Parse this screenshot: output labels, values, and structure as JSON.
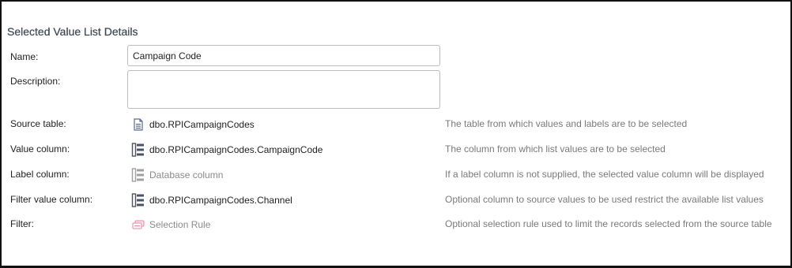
{
  "section": {
    "title": "Selected Value List Details"
  },
  "fields": {
    "name": {
      "label": "Name:",
      "value": "Campaign Code"
    },
    "description": {
      "label": "Description:",
      "value": ""
    }
  },
  "rows": {
    "source_table": {
      "label": "Source table:",
      "value": "dbo.RPICampaignCodes",
      "icon": "table-document-icon",
      "help": "The table from which values and labels are to be selected"
    },
    "value_column": {
      "label": "Value column:",
      "value": "dbo.RPICampaignCodes.CampaignCode",
      "icon": "database-column-icon",
      "help": "The column from which list values are to be selected"
    },
    "label_column": {
      "label": "Label column:",
      "value": "Database column",
      "icon": "database-column-icon",
      "help": "If a label column is not supplied, the selected value column will be displayed"
    },
    "filter_value_column": {
      "label": "Filter value column:",
      "value": "dbo.RPICampaignCodes.Channel",
      "icon": "database-column-icon",
      "help": "Optional column to source values to be used restrict the available list values"
    },
    "filter": {
      "label": "Filter:",
      "value": "Selection Rule",
      "icon": "selection-rule-icon",
      "help": "Optional selection rule used to limit the records selected from the source table"
    }
  },
  "colors": {
    "accent_icon": "#5b6b8c",
    "placeholder_icon": "#a0a0a0",
    "rule_icon": "#e58aa6",
    "help_text": "#7a7a7a"
  }
}
